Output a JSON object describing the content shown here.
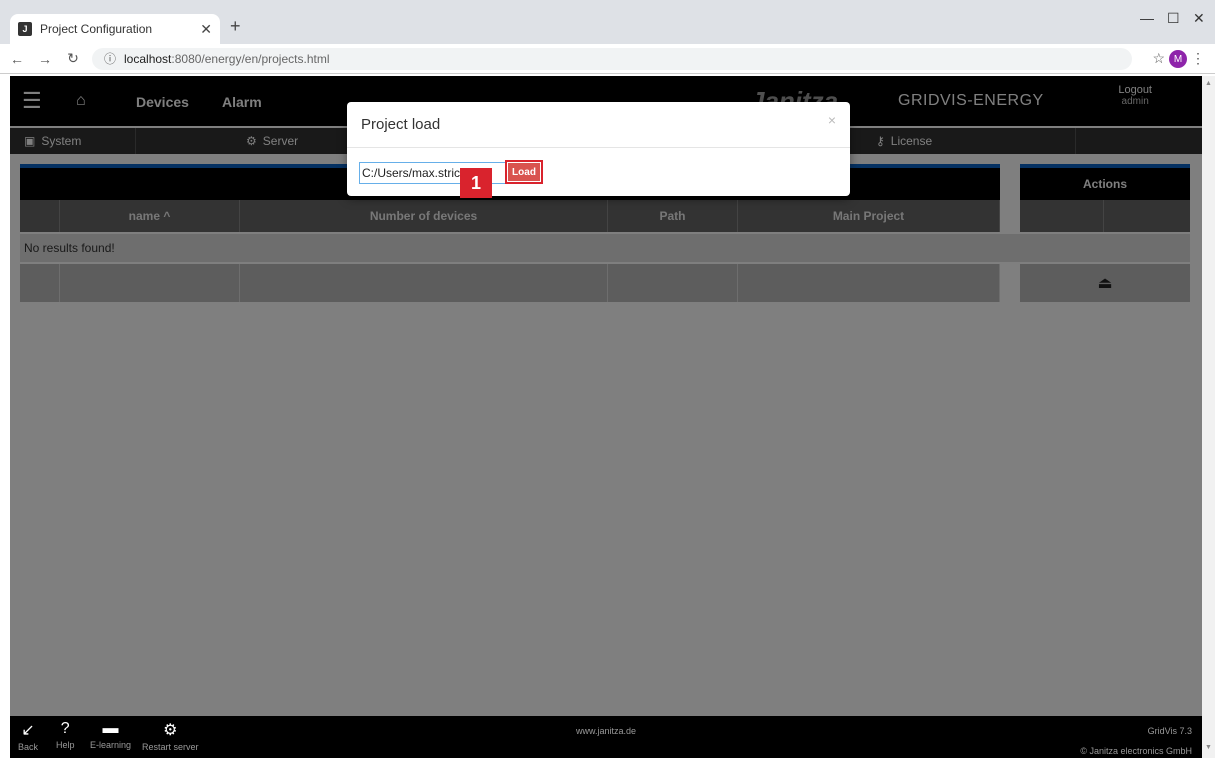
{
  "browser": {
    "tab_title": "Project Configuration",
    "tab_favicon_letter": "J",
    "url_host": "localhost",
    "url_path": ":8080/energy/en/projects.html"
  },
  "nav": {
    "devices": "Devices",
    "alarm": "Alarm",
    "brand": "Janitza",
    "brand_sub": "GRIDVIS-ENERGY",
    "logout": "Logout",
    "user": "admin"
  },
  "subnav": {
    "system": "System",
    "server": "Server",
    "license": "License"
  },
  "table": {
    "actions_header": "Actions",
    "columns": [
      "name ^",
      "Number of devices",
      "Path",
      "Main Project"
    ],
    "empty_message": "No results found!"
  },
  "footer": {
    "items": [
      "Back",
      "Help",
      "E-learning",
      "Restart server"
    ],
    "center": "www.janitza.de",
    "version": "GridVis 7.3",
    "copyright": "© Janitza electronics GmbH"
  },
  "modal": {
    "title": "Project load",
    "path_value": "C:/Users/max.strick",
    "load_label": "Load",
    "step_number": "1"
  }
}
